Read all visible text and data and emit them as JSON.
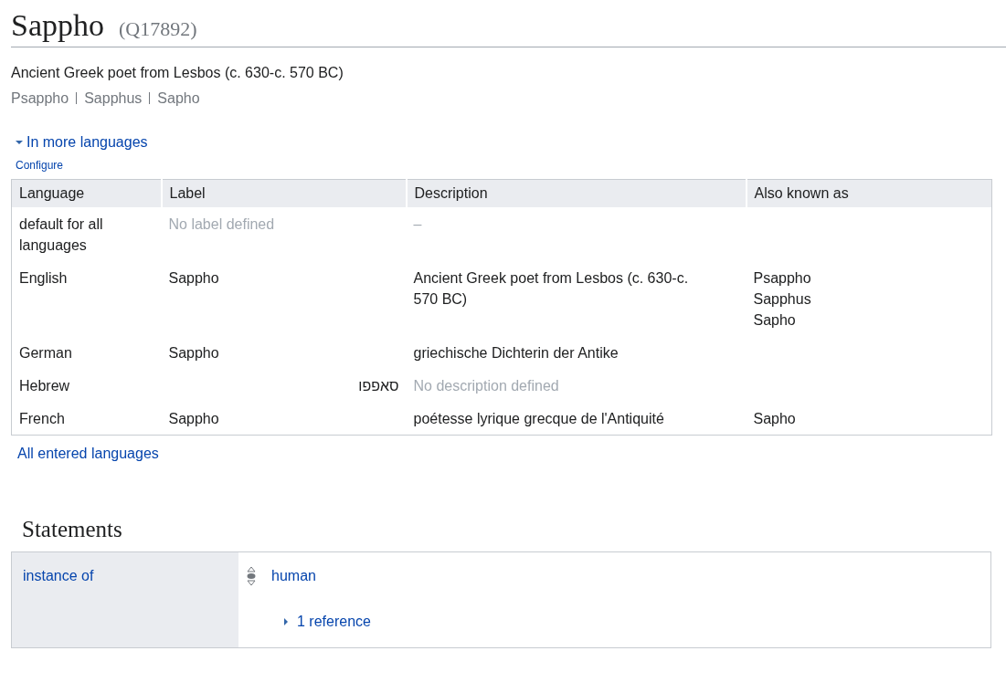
{
  "title": "Sappho",
  "item_id": "(Q17892)",
  "description": "Ancient Greek poet from Lesbos (c. 630-c. 570 BC)",
  "aliases": [
    "Psappho",
    "Sapphus",
    "Sapho"
  ],
  "languages_toggle": {
    "label": "In more languages",
    "expanded": true
  },
  "configure_link": "Configure",
  "languages_table": {
    "columns": [
      "Language",
      "Label",
      "Description",
      "Also known as"
    ],
    "rows": [
      {
        "language": "default for all languages",
        "label": "No label defined",
        "label_missing": true,
        "label_rtl": false,
        "description": "–",
        "description_missing": true,
        "aliases": []
      },
      {
        "language": "English",
        "label": "Sappho",
        "label_missing": false,
        "label_rtl": false,
        "description": "Ancient Greek poet from Lesbos (c. 630-c. 570 BC)",
        "description_missing": false,
        "aliases": [
          "Psappho",
          "Sapphus",
          "Sapho"
        ]
      },
      {
        "language": "German",
        "label": "Sappho",
        "label_missing": false,
        "label_rtl": false,
        "description": "griechische Dichterin der Antike",
        "description_missing": false,
        "aliases": []
      },
      {
        "language": "Hebrew",
        "label": "סאפפו",
        "label_missing": false,
        "label_rtl": true,
        "description": "No description defined",
        "description_missing": true,
        "aliases": []
      },
      {
        "language": "French",
        "label": "Sappho",
        "label_missing": false,
        "label_rtl": false,
        "description": "poétesse lyrique grecque de l'Antiquité",
        "description_missing": false,
        "aliases": [
          "Sapho"
        ]
      }
    ]
  },
  "all_languages_link": "All entered languages",
  "statements": {
    "heading": "Statements",
    "items": [
      {
        "property": "instance of",
        "value": "human",
        "references": {
          "label": "1 reference",
          "expanded": false
        }
      }
    ]
  }
}
